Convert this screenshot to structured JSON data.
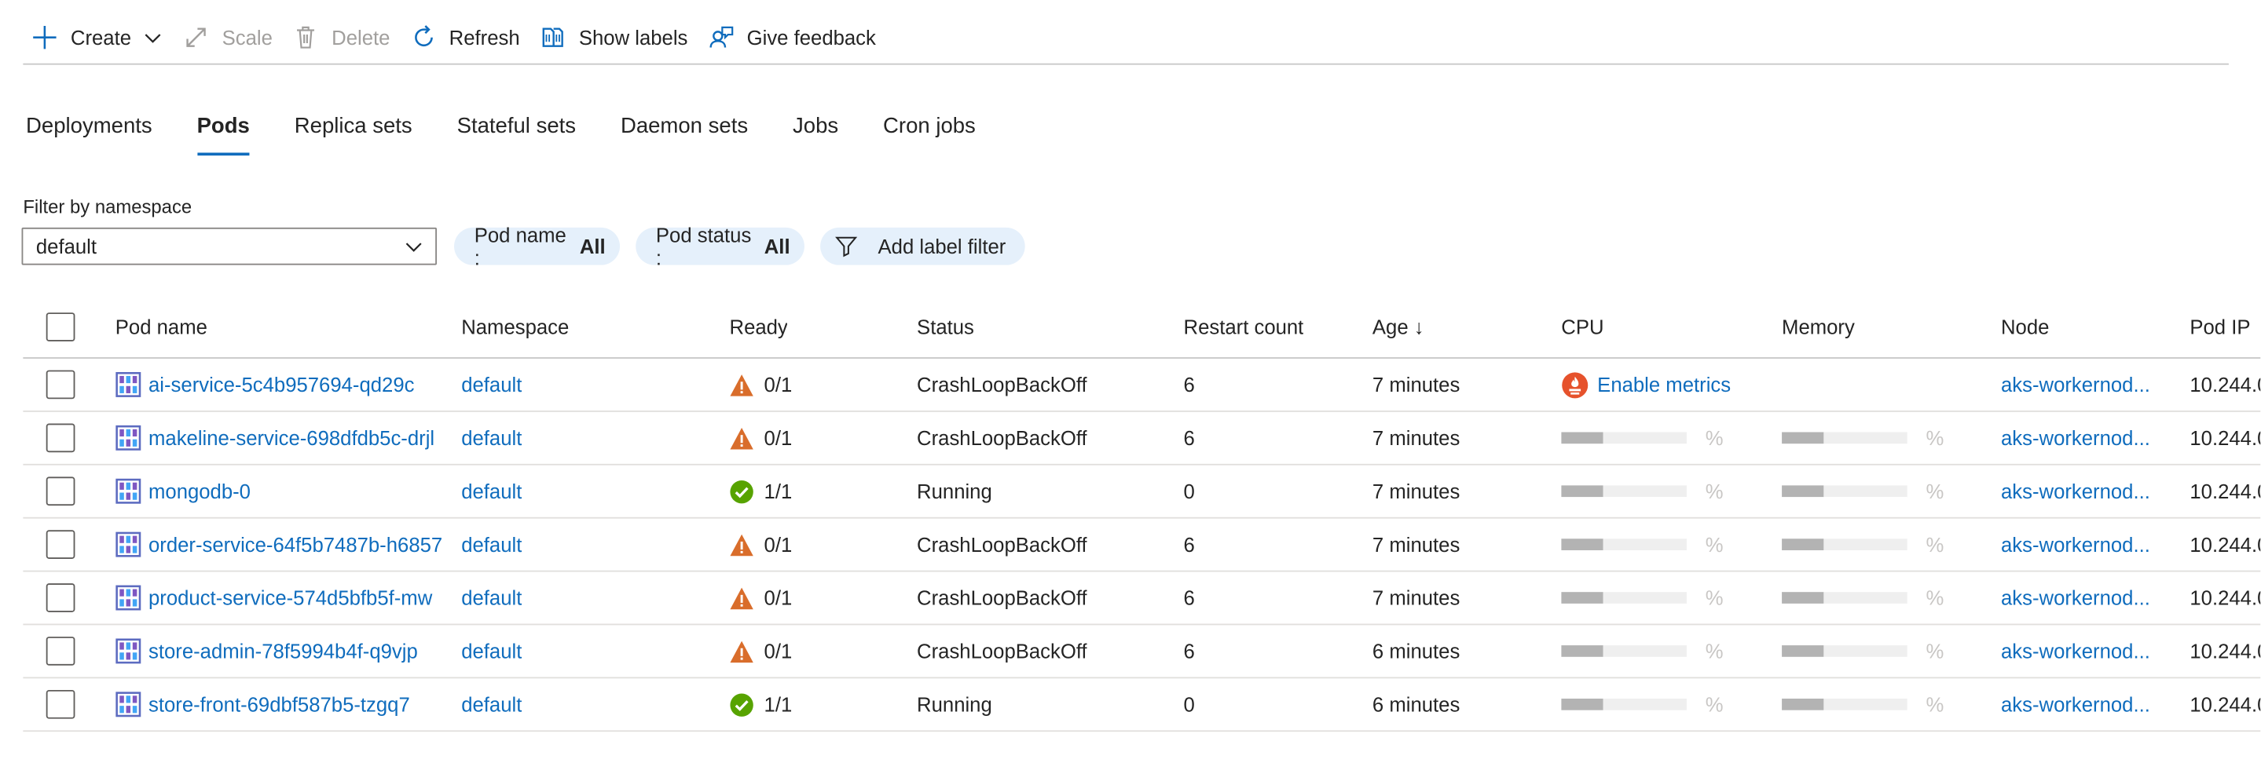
{
  "toolbar": {
    "create": "Create",
    "scale": "Scale",
    "delete": "Delete",
    "refresh": "Refresh",
    "show_labels": "Show labels",
    "give_feedback": "Give feedback"
  },
  "tabs": [
    "Deployments",
    "Pods",
    "Replica sets",
    "Stateful sets",
    "Daemon sets",
    "Jobs",
    "Cron jobs"
  ],
  "active_tab": "Pods",
  "filter": {
    "label": "Filter by namespace",
    "namespace_value": "default",
    "pod_name_label": "Pod name :",
    "pod_name_value": "All",
    "pod_status_label": "Pod status :",
    "pod_status_value": "All",
    "add_label_filter": "Add label filter"
  },
  "columns": {
    "pod_name": "Pod name",
    "namespace": "Namespace",
    "ready": "Ready",
    "status": "Status",
    "restart": "Restart count",
    "age": "Age ↓",
    "cpu": "CPU",
    "memory": "Memory",
    "node": "Node",
    "pod_ip": "Pod IP"
  },
  "enable_metrics": "Enable metrics",
  "percent_symbol": "%",
  "colors": {
    "link": "#0f6cbd",
    "warning": "#d96d2b",
    "ok": "#57a300",
    "active_tab": "#0f6cbd",
    "pill_bg": "#e5f0fb"
  },
  "rows": [
    {
      "name": "ai-service-5c4b957694-qd29c",
      "namespace": "default",
      "ready_icon": "warning-icon",
      "ready": "0/1",
      "status": "CrashLoopBackOff",
      "restarts": "6",
      "age": "7 minutes",
      "metrics": false,
      "node": "aks-workernod...",
      "ip": "10.244.0."
    },
    {
      "name": "makeline-service-698dfdb5c-drjl",
      "namespace": "default",
      "ready_icon": "warning-icon",
      "ready": "0/1",
      "status": "CrashLoopBackOff",
      "restarts": "6",
      "age": "7 minutes",
      "metrics": true,
      "node": "aks-workernod...",
      "ip": "10.244.0."
    },
    {
      "name": "mongodb-0",
      "namespace": "default",
      "ready_icon": "check-icon",
      "ready": "1/1",
      "status": "Running",
      "restarts": "0",
      "age": "7 minutes",
      "metrics": true,
      "node": "aks-workernod...",
      "ip": "10.244.0."
    },
    {
      "name": "order-service-64f5b7487b-h6857",
      "namespace": "default",
      "ready_icon": "warning-icon",
      "ready": "0/1",
      "status": "CrashLoopBackOff",
      "restarts": "6",
      "age": "7 minutes",
      "metrics": true,
      "node": "aks-workernod...",
      "ip": "10.244.0."
    },
    {
      "name": "product-service-574d5bfb5f-mw",
      "namespace": "default",
      "ready_icon": "warning-icon",
      "ready": "0/1",
      "status": "CrashLoopBackOff",
      "restarts": "6",
      "age": "7 minutes",
      "metrics": true,
      "node": "aks-workernod...",
      "ip": "10.244.0."
    },
    {
      "name": "store-admin-78f5994b4f-q9vjp",
      "namespace": "default",
      "ready_icon": "warning-icon",
      "ready": "0/1",
      "status": "CrashLoopBackOff",
      "restarts": "6",
      "age": "6 minutes",
      "metrics": true,
      "node": "aks-workernod...",
      "ip": "10.244.0."
    },
    {
      "name": "store-front-69dbf587b5-tzgq7",
      "namespace": "default",
      "ready_icon": "check-icon",
      "ready": "1/1",
      "status": "Running",
      "restarts": "0",
      "age": "6 minutes",
      "metrics": true,
      "node": "aks-workernod...",
      "ip": "10.244.0."
    }
  ]
}
